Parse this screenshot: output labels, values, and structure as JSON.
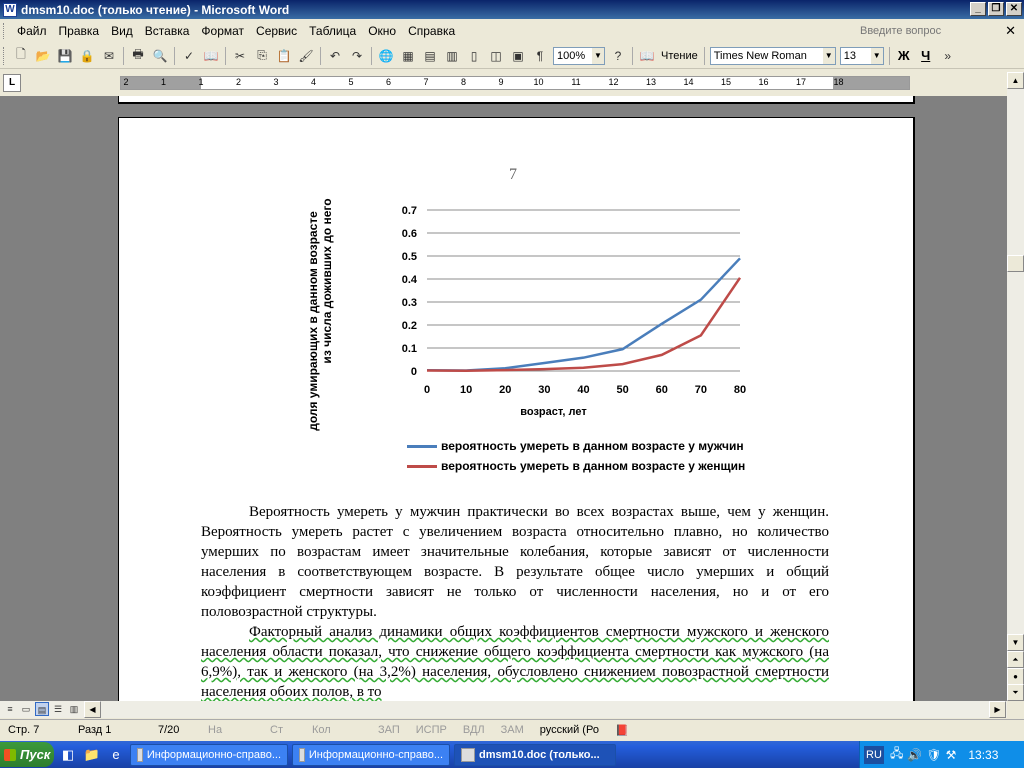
{
  "window": {
    "title": "dmsm10.doc (только чтение) - Microsoft Word"
  },
  "menu": {
    "items": [
      "Файл",
      "Правка",
      "Вид",
      "Вставка",
      "Формат",
      "Сервис",
      "Таблица",
      "Окно",
      "Справка"
    ],
    "help_placeholder": "Введите вопрос"
  },
  "toolbar": {
    "zoom": "100%",
    "reading_label": "Чтение",
    "font": "Times New Roman",
    "size": "13",
    "bold": "Ж",
    "underline": "Ч"
  },
  "ruler": {
    "labels": [
      "2",
      "1",
      "1",
      "2",
      "3",
      "4",
      "5",
      "6",
      "7",
      "8",
      "9",
      "10",
      "11",
      "12",
      "13",
      "14",
      "15",
      "16",
      "17",
      "18"
    ]
  },
  "page": {
    "number": "7"
  },
  "chart_data": {
    "type": "line",
    "x": [
      0,
      10,
      20,
      30,
      40,
      50,
      60,
      70,
      80
    ],
    "xlabel": "возраст, лет",
    "ylabel": "доля умирающих в данном возрасте из числа доживших до него",
    "ylabel_line1": "доля умирающих в данном возрасте",
    "ylabel_line2": "из числа доживших до него",
    "ylim": [
      0,
      0.7
    ],
    "yticks": [
      "0",
      "0.1",
      "0.2",
      "0.3",
      "0.4",
      "0.5",
      "0.6",
      "0.7"
    ],
    "grid": true,
    "legend": "bottom",
    "series": [
      {
        "name": "вероятность умереть в данном возрасте у мужчин",
        "color": "#4a7ebb",
        "values": [
          0.003,
          0.002,
          0.012,
          0.035,
          0.058,
          0.095,
          0.205,
          0.31,
          0.49
        ]
      },
      {
        "name": "вероятность умереть в данном возрасте у женщин",
        "color": "#be4b48",
        "values": [
          0.002,
          0.001,
          0.004,
          0.008,
          0.014,
          0.03,
          0.07,
          0.155,
          0.405
        ]
      }
    ]
  },
  "body": {
    "p1": "Вероятность умереть у мужчин практически во  всех возрастах выше, чем у женщин. Вероятность умереть растет с увеличением возраста относительно плавно, но количество умерших по возрастам имеет значительные колебания, которые зависят от численности населения в соответствующем возрасте. В результате общее число умерших и общий коэффициент смертности зависят не только от численности населения, но и от его половозрастной структуры.",
    "p2": "Факторный анализ динамики общих коэффициентов смертности мужского и женского населения области показал, что снижение общего коэффициента смертности как мужского (на 6,9%), так и женского (на 3,2%) населения, обусловлено снижением повозрастной смертности населения обоих полов, в то"
  },
  "status": {
    "page": "Стр. 7",
    "section": "Разд 1",
    "pages": "7/20",
    "at": "На",
    "line": "Ст",
    "col": "Кол",
    "rec": "ЗАП",
    "trk": "ИСПР",
    "ext": "ВДЛ",
    "ovr": "ЗАМ",
    "lang": "русский (Ро"
  },
  "taskbar": {
    "start": "Пуск",
    "tasks": [
      "Информационно-справо...",
      "Информационно-справо...",
      "dmsm10.doc (только..."
    ],
    "lang": "RU",
    "clock": "13:33"
  }
}
